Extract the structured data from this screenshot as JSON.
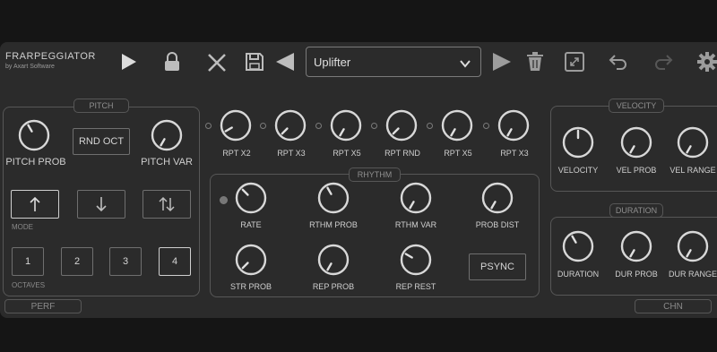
{
  "app": {
    "title": "FRARPEGGIATOR",
    "subtitle": "by Axart Software"
  },
  "preset": {
    "name": "Uplifter"
  },
  "icons": {
    "play": "play-icon",
    "lock": "lock-icon",
    "close": "close-icon",
    "save": "save-icon",
    "prev": "prev-preset-icon",
    "next": "next-preset-icon",
    "delete": "trash-icon",
    "resize": "resize-icon",
    "undo": "undo-icon",
    "redo": "redo-icon",
    "settings": "gear-icon"
  },
  "pitch": {
    "title": "PITCH",
    "pitch_prob": "PITCH PROB",
    "rnd_oct": "RND OCT",
    "pitch_var": "PITCH VAR",
    "mode_label": "MODE",
    "octaves_label": "OCTAVES",
    "octaves": [
      "1",
      "2",
      "3",
      "4"
    ],
    "selected_octave": "4",
    "selected_mode": "up"
  },
  "repeats": [
    {
      "label": "RPT X2"
    },
    {
      "label": "RPT X3"
    },
    {
      "label": "RPT X5"
    },
    {
      "label": "RPT RND"
    },
    {
      "label": "RPT X5"
    },
    {
      "label": "RPT X3"
    }
  ],
  "rhythm": {
    "title": "RHYTHM",
    "rate": "RATE",
    "rthm_prob": "RTHM PROB",
    "rthm_var": "RTHM VAR",
    "prob_dist": "PROB DIST",
    "str_prob": "STR PROB",
    "rep_prob": "REP PROB",
    "rep_rest": "REP REST",
    "psync": "PSYNC"
  },
  "velocity": {
    "title": "VELOCITY",
    "velocity": "VELOCITY",
    "vel_prob": "VEL PROB",
    "vel_range": "VEL RANGE"
  },
  "duration": {
    "title": "DURATION",
    "duration": "DURATION",
    "dur_prob": "DUR PROB",
    "dur_range": "DUR RANGE"
  },
  "footer": {
    "perf": "PERF",
    "chn": "CHN"
  },
  "colors": {
    "background": "#151515",
    "panel": "#2b2b2b",
    "border": "#575757",
    "knob": "#d8d8d8"
  }
}
